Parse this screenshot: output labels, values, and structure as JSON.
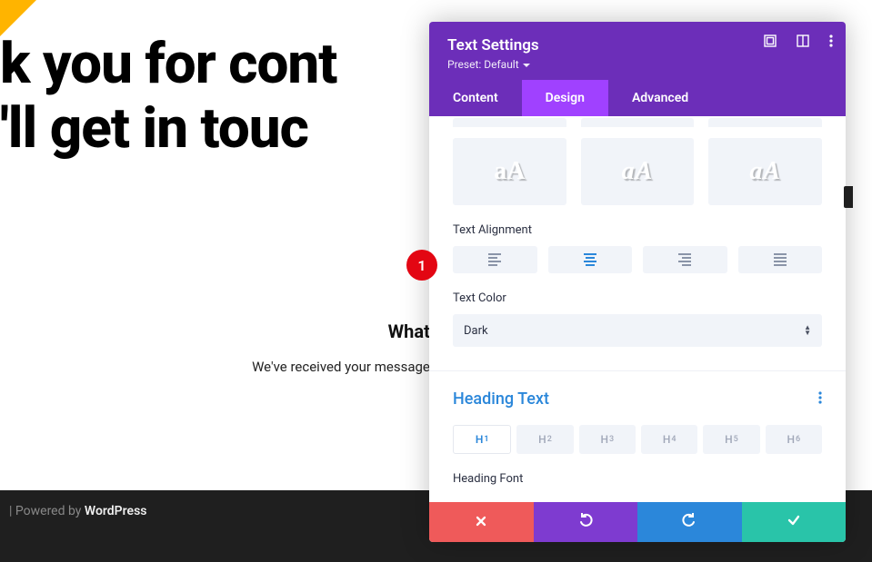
{
  "page": {
    "hero_line1": "k you for cont",
    "hero_line2": "'ll get in touc",
    "whats_next_title": "What's Next",
    "whats_next_body": "We've received your message and we'll send you an email wit"
  },
  "footer": {
    "prefix": " | Powered by ",
    "brand": "WordPress"
  },
  "panel": {
    "title": "Text Settings",
    "preset_label": "Preset: Default",
    "tabs": {
      "content": "Content",
      "design": "Design",
      "advanced": "Advanced"
    },
    "text_alignment_label": "Text Alignment",
    "text_color_label": "Text Color",
    "text_color_value": "Dark",
    "heading_text_label": "Heading Text",
    "heading_font_label": "Heading Font",
    "h_tabs": [
      "H1",
      "H2",
      "H3",
      "H4",
      "H5",
      "H6"
    ]
  },
  "marker": {
    "num": "1"
  }
}
